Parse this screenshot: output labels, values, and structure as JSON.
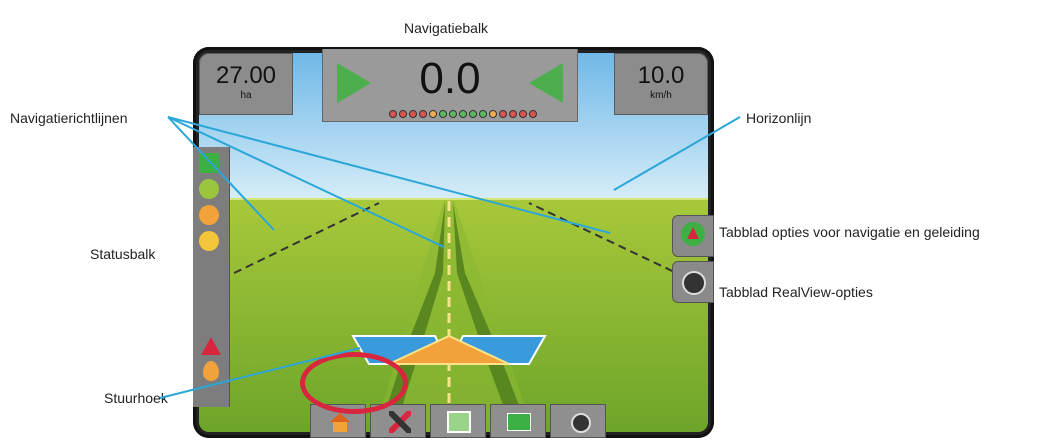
{
  "callouts": {
    "navigatiebalk": "Navigatiebalk",
    "navigatierichtlijnen": "Navigatierichtlijnen",
    "horizonlijn": "Horizonlijn",
    "statusbalk": "Statusbalk",
    "tab_navigatie": "Tabblad opties voor navigatie en geleiding",
    "tab_realview": "Tabblad RealView-opties",
    "stuurhoek": "Stuurhoek"
  },
  "screen": {
    "area_value": "27.00",
    "area_unit": "ha",
    "crosstrack_value": "0.0",
    "speed_value": "10.0",
    "speed_unit": "km/h"
  },
  "lightbar_colors": [
    "#d9534f",
    "#d9534f",
    "#d9534f",
    "#d9534f",
    "#f0ad4e",
    "#5cb85c",
    "#5cb85c",
    "#5cb85c",
    "#5cb85c",
    "#5cb85c",
    "#f0ad4e",
    "#d9534f",
    "#d9534f",
    "#d9534f",
    "#d9534f"
  ],
  "icons": {
    "status": [
      "status-green-icon",
      "status-line-icon",
      "status-warning-icon",
      "status-gps-icon",
      "status-boom-icon",
      "status-droplet-icon"
    ],
    "bottom": [
      "home-icon",
      "tools-icon",
      "guidance-view-icon",
      "navigation-tab-icon",
      "realview-icon"
    ],
    "side": [
      "navigation-options-icon",
      "realview-options-icon"
    ]
  },
  "colors": {
    "steer_bar": "#3a9bdc",
    "steer_triangle": "#f2a23a",
    "highlight_circle": "#d7263d",
    "callout_line": "#2aa7d8"
  }
}
